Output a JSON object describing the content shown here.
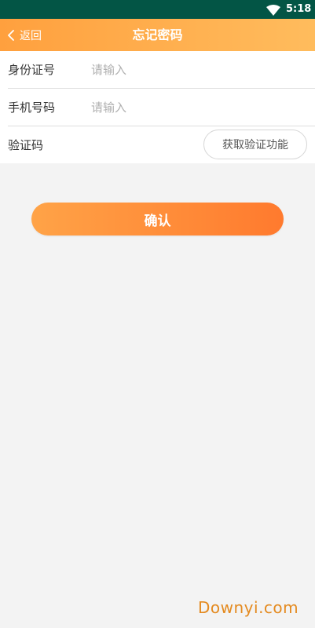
{
  "status_bar": {
    "time": "5:18",
    "wifi_icon": "wifi-icon",
    "background": "#035545"
  },
  "app_bar": {
    "back_label": "返回",
    "back_icon": "chevron-left-icon",
    "title": "忘记密码",
    "gradient": [
      "#ffa03e",
      "#ffbc5d"
    ]
  },
  "form": {
    "id_card": {
      "label": "身份证号",
      "value": "",
      "placeholder": "请输入"
    },
    "phone": {
      "label": "手机号码",
      "value": "",
      "placeholder": "请输入"
    },
    "verification": {
      "label": "验证码",
      "button_label": "获取验证功能"
    }
  },
  "confirm": {
    "label": "确认",
    "gradient": [
      "#ffa347",
      "#ff7a2e"
    ]
  },
  "watermark": {
    "text": "Downyi.com",
    "color": "#e48a1f"
  }
}
